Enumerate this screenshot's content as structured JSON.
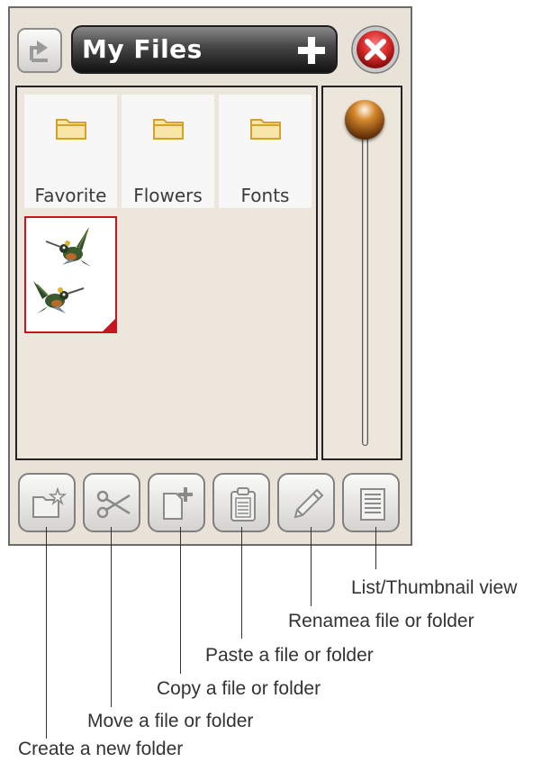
{
  "header": {
    "title": "My Files"
  },
  "files": [
    {
      "name": "Favorite",
      "type": "folder"
    },
    {
      "name": "Flowers",
      "type": "folder"
    },
    {
      "name": "Fonts",
      "type": "folder"
    },
    {
      "name": "",
      "type": "design"
    }
  ],
  "toolbar": [
    {
      "icon": "create-folder-icon"
    },
    {
      "icon": "scissors-icon"
    },
    {
      "icon": "copy-icon"
    },
    {
      "icon": "clipboard-icon"
    },
    {
      "icon": "pencil-icon"
    },
    {
      "icon": "list-view-icon"
    }
  ],
  "callouts": {
    "create": "Create a new folder",
    "move": "Move a file or folder",
    "copy": "Copy a file or folder",
    "paste": "Paste a file or folder",
    "rename": "Renamea file or folder",
    "view": "List/Thumbnail view"
  },
  "colors": {
    "title_bar": "#1e1e1e",
    "close_red": "#d42a2a",
    "selection_border": "#c8141e",
    "folder": "#e9c35a",
    "knob": "#d4862a"
  }
}
